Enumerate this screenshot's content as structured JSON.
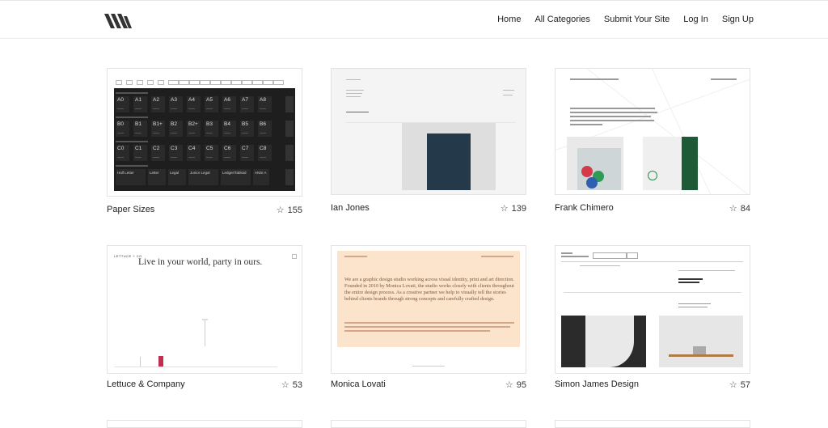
{
  "nav": {
    "home": "Home",
    "categories": "All Categories",
    "submit": "Submit Your Site",
    "login": "Log In",
    "signup": "Sign Up"
  },
  "cards": [
    {
      "title": "Paper Sizes",
      "stars": "155"
    },
    {
      "title": "Ian Jones",
      "stars": "139"
    },
    {
      "title": "Frank Chimero",
      "stars": "84"
    },
    {
      "title": "Lettuce & Company",
      "stars": "53"
    },
    {
      "title": "Monica Lovati",
      "stars": "95"
    },
    {
      "title": "Simon James Design",
      "stars": "57"
    }
  ],
  "thumbs": {
    "paper_sizes": {
      "rows": [
        [
          "A0",
          "A1",
          "A2",
          "A3",
          "A4",
          "A5",
          "A6",
          "A7",
          "A8"
        ],
        [
          "B0",
          "B1",
          "B1+",
          "B2",
          "B2+",
          "B3",
          "B4",
          "B5",
          "B6"
        ],
        [
          "C0",
          "C1",
          "C2",
          "C3",
          "C4",
          "C5",
          "C6",
          "C7",
          "C8"
        ]
      ],
      "letter_row": [
        "Half Letter",
        "Letter",
        "Legal",
        "Junior Legal",
        "Ledger/Tabloid",
        "ANSI A"
      ]
    },
    "lettuce": {
      "brand": "LETTUCE + CO",
      "headline": "Live in your world, party in ours."
    },
    "monica": {
      "body": "We are a graphic design studio working across visual identity, print and art direction. Founded in 2010 by Monica Lovati, the studio works closely with clients throughout the entire design process. As a creative partner we help to visually tell the stories behind clients brands through strong concepts and carefully crafted design."
    }
  },
  "colors": {
    "accent_green": "#1f5a36",
    "book_navy": "#24394a",
    "peach": "#fbe3cc",
    "lettuce_red": "#c0304e"
  }
}
